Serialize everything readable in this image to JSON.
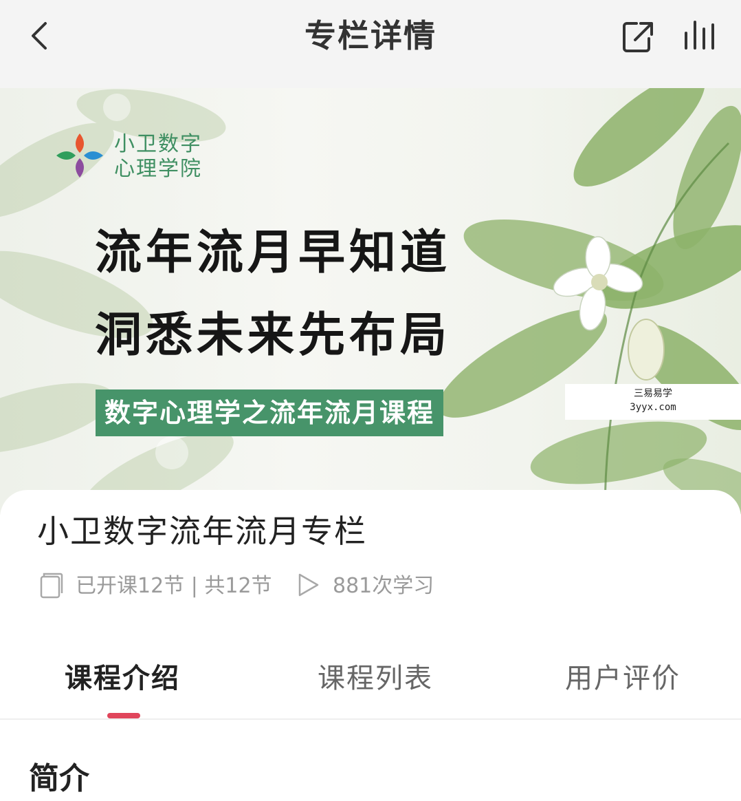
{
  "header": {
    "title": "专栏详情",
    "back_icon": "chevron-left-icon",
    "share_icon": "share-icon",
    "stats_icon": "bar-chart-icon"
  },
  "banner": {
    "brand_line1": "小卫数字",
    "brand_line2": "心理学院",
    "headline_line1": "流年流月早知道",
    "headline_line2": "洞悉未来先布局",
    "course_tag": "数字心理学之流年流月课程",
    "watermark_line1": "三易易学",
    "watermark_line2": "3yyx.com",
    "colors": {
      "brand_green": "#3f8f62",
      "tag_bg": "#47946a"
    }
  },
  "course": {
    "title": "小卫数字流年流月专栏",
    "lessons": "已开课12节 | 共12节",
    "study_count": "881次学习"
  },
  "tabs": [
    {
      "label": "课程介绍",
      "active": true
    },
    {
      "label": "课程列表",
      "active": false
    },
    {
      "label": "用户评价",
      "active": false
    }
  ],
  "intro": {
    "heading": "简介"
  },
  "colors": {
    "accent": "#e0455b",
    "header_bg": "#f4f4f4"
  }
}
